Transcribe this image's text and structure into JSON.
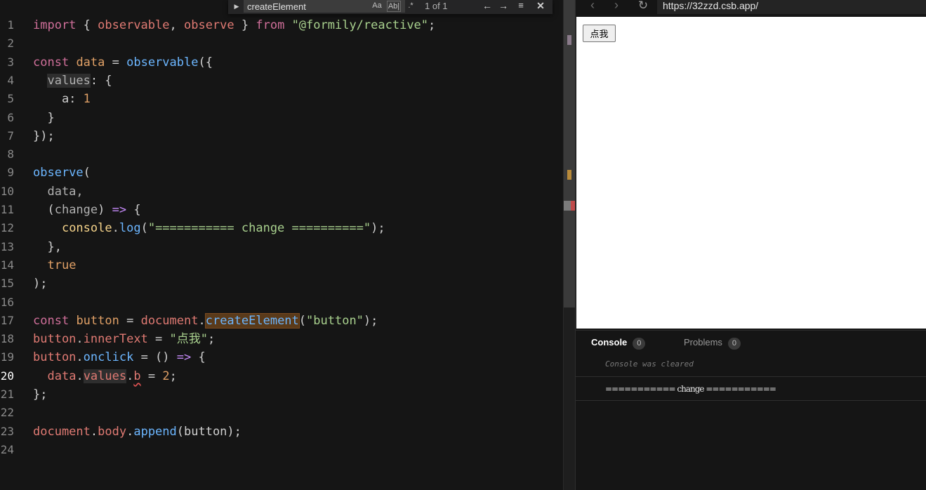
{
  "find_widget": {
    "toggle_icon": "chevron-right-icon",
    "query": "createElement",
    "match_case_label": "Aa",
    "whole_word_label": "Ab|",
    "regex_label": ".*",
    "count": "1 of 1",
    "prev_icon": "arrow-up-icon",
    "next_icon": "arrow-down-icon",
    "selection_icon": "find-in-selection-icon",
    "close_icon": "close-icon"
  },
  "editor": {
    "active_line": 20,
    "lines": [
      {
        "n": "1"
      },
      {
        "n": "2"
      },
      {
        "n": "3"
      },
      {
        "n": "4"
      },
      {
        "n": "5"
      },
      {
        "n": "6"
      },
      {
        "n": "7"
      },
      {
        "n": "8"
      },
      {
        "n": "9"
      },
      {
        "n": "10"
      },
      {
        "n": "11"
      },
      {
        "n": "12"
      },
      {
        "n": "13"
      },
      {
        "n": "14"
      },
      {
        "n": "15"
      },
      {
        "n": "16"
      },
      {
        "n": "17"
      },
      {
        "n": "18"
      },
      {
        "n": "19"
      },
      {
        "n": "20"
      },
      {
        "n": "21"
      },
      {
        "n": "22"
      },
      {
        "n": "23"
      },
      {
        "n": "24"
      }
    ],
    "tokens": {
      "l1": [
        "import",
        " { ",
        "observable",
        ", ",
        "observe",
        " } ",
        "from",
        " ",
        "\"@formily/reactive\"",
        ";"
      ],
      "l3": [
        "const",
        " ",
        "data",
        " = ",
        "observable",
        "({"
      ],
      "l4": [
        "  ",
        "values",
        ": {"
      ],
      "l5": [
        "    a: ",
        "1"
      ],
      "l6": [
        "  }"
      ],
      "l7": [
        "});"
      ],
      "l9": [
        "observe",
        "("
      ],
      "l10": [
        "  data,"
      ],
      "l11": [
        "  (",
        "change",
        ") ",
        "=>",
        " {"
      ],
      "l12": [
        "    ",
        "console",
        ".",
        "log",
        "(",
        "\"=========== change ==========\"",
        ");"
      ],
      "l13": [
        "  },"
      ],
      "l14": [
        "  ",
        "true"
      ],
      "l15": [
        ");"
      ],
      "l17": [
        "const",
        " ",
        "button",
        " = ",
        "document",
        ".",
        "createElement",
        "(",
        "\"button\"",
        ");"
      ],
      "l18": [
        "button",
        ".",
        "innerText",
        " = ",
        "\"点我\"",
        ";"
      ],
      "l19": [
        "button",
        ".",
        "onclick",
        " = () ",
        "=>",
        " {"
      ],
      "l20": [
        "  ",
        "data",
        ".",
        "values",
        ".",
        "b",
        " = ",
        "2",
        ";"
      ],
      "l21": [
        "};"
      ],
      "l23": [
        "document",
        ".",
        "body",
        ".",
        "append",
        "(button);"
      ]
    }
  },
  "browser": {
    "back_icon": "chevron-left-icon",
    "forward_icon": "chevron-right-icon",
    "refresh_icon": "refresh-icon",
    "url": "https://32zzd.csb.app/",
    "page_button_label": "点我"
  },
  "console": {
    "tabs": [
      {
        "label": "Console",
        "count": "0",
        "active": true
      },
      {
        "label": "Problems",
        "count": "0",
        "active": false
      }
    ],
    "cleared_message": "Console was cleared",
    "log_entry": "=========== change ==========="
  },
  "colors": {
    "editor_bg": "#151515",
    "keyword": "#d06f9a",
    "function": "#6cb6ff",
    "string": "#a9d18e",
    "property": "#e07a73",
    "number": "#e0a066",
    "find_highlight": "#5a3a1a"
  }
}
